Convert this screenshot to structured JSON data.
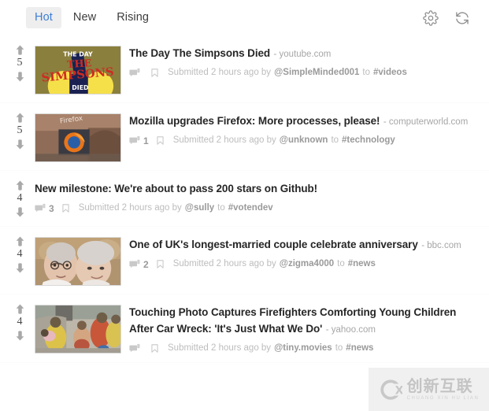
{
  "header": {
    "tabs": [
      {
        "label": "Hot",
        "active": true
      },
      {
        "label": "New",
        "active": false
      },
      {
        "label": "Rising",
        "active": false
      }
    ],
    "actions": [
      {
        "name": "settings-button",
        "icon": "gear-icon"
      },
      {
        "name": "refresh-button",
        "icon": "refresh-icon"
      }
    ]
  },
  "meta_labels": {
    "submitted": "Submitted",
    "by": "by",
    "to": "to"
  },
  "posts": [
    {
      "score": "5",
      "title": "The Day The Simpsons Died",
      "domain": "- youtube.com",
      "comments": "",
      "submitted_text": "Submitted 2 hours ago by",
      "author": "@SimpleMinded001",
      "to_text": "to",
      "community": "#videos",
      "thumbnail": "simpsons",
      "has_thumbnail": true
    },
    {
      "score": "5",
      "title": "Mozilla upgrades Firefox: More processes, please!",
      "domain": "- computerworld.com",
      "comments": "1",
      "submitted_text": "Submitted 2 hours ago by",
      "author": "@unknown",
      "to_text": "to",
      "community": "#technology",
      "thumbnail": "firefox",
      "has_thumbnail": true
    },
    {
      "score": "4",
      "title": "New milestone: We're about to pass 200 stars on Github!",
      "domain": "",
      "comments": "3",
      "submitted_text": "Submitted 2 hours ago by",
      "author": "@sully",
      "to_text": "to",
      "community": "#votendev",
      "thumbnail": "",
      "has_thumbnail": false
    },
    {
      "score": "4",
      "title": "One of UK's longest-married couple celebrate anniversary",
      "domain": "- bbc.com",
      "comments": "2",
      "submitted_text": "Submitted 2 hours ago by",
      "author": "@zigma4000",
      "to_text": "to",
      "community": "#news",
      "thumbnail": "couple",
      "has_thumbnail": true
    },
    {
      "score": "4",
      "title": "Touching Photo Captures Firefighters Comforting Young Children After Car Wreck: 'It's Just What We Do'",
      "domain": "- yahoo.com",
      "comments": "",
      "submitted_text": "Submitted 2 hours ago by",
      "author": "@tiny.movies",
      "to_text": "to",
      "community": "#news",
      "thumbnail": "firefighters",
      "has_thumbnail": true
    }
  ],
  "watermark": {
    "chinese": "创新互联",
    "pinyin": "CHUANG XIN HU LIAN",
    "logo_letter": "X"
  },
  "colors": {
    "accent": "#3e7fd4",
    "title": "#262626",
    "muted": "#bdbdbd",
    "tab_active_bg": "#eeeeee"
  }
}
